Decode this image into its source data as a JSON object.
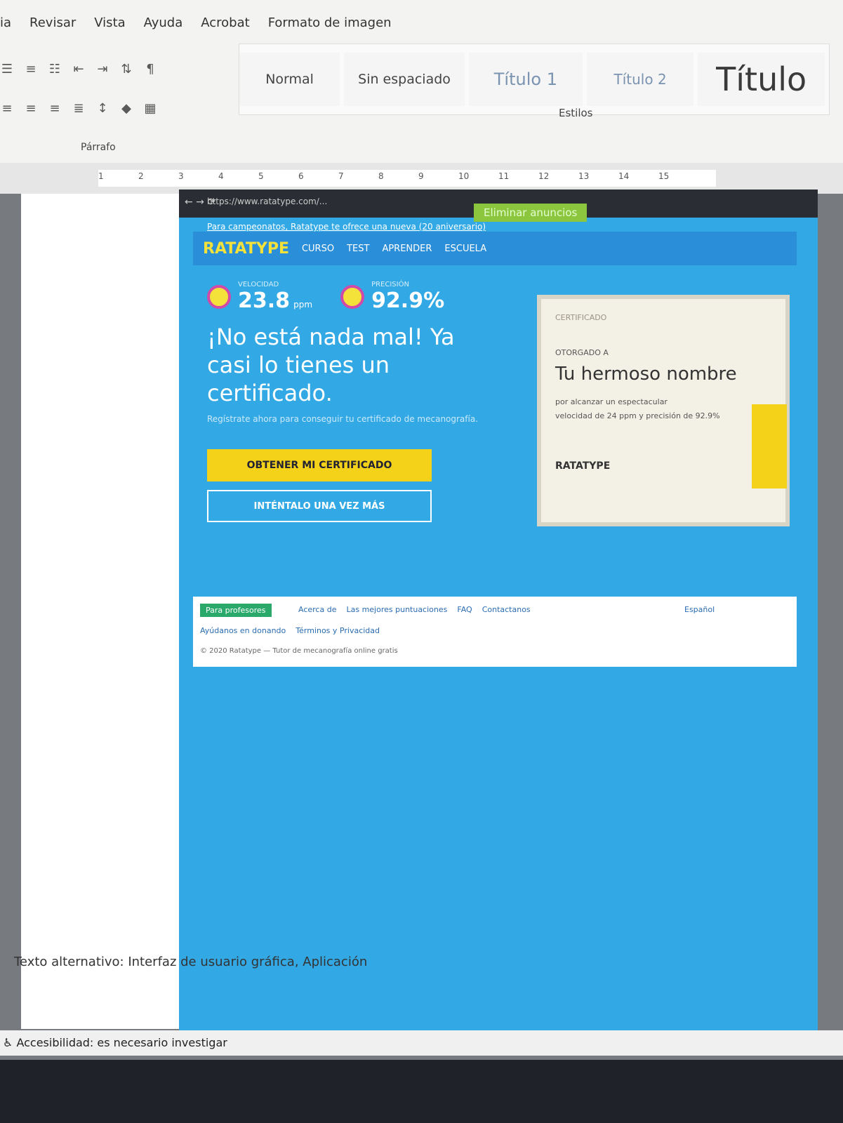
{
  "menu": [
    "ia",
    "Revisar",
    "Vista",
    "Ayuda",
    "Acrobat",
    "Formato de imagen"
  ],
  "paragraph_group_label": "Párrafo",
  "styles": {
    "normal": "Normal",
    "sin_espaciado": "Sin espaciado",
    "titulo1": "Título 1",
    "titulo2": "Título 2",
    "titulo": "Título",
    "group_label": "Estilos"
  },
  "ruler": [
    "1",
    "2",
    "3",
    "4",
    "5",
    "6",
    "7",
    "8",
    "9",
    "10",
    "11",
    "12",
    "13",
    "14",
    "15"
  ],
  "browser": {
    "url": "https://www.ratatype.com/...",
    "promo_link": "Para campeonatos, Ratatype te ofrece una nueva (20 aniversario)",
    "delete_button": "Eliminar anuncios",
    "logo": "RATATYPE",
    "nav": [
      "CURSO",
      "TEST",
      "APRENDER",
      "ESCUELA"
    ],
    "speed_label": "VELOCIDAD",
    "speed_value": "23.8",
    "speed_unit": "ppm",
    "accuracy_label": "PRECISIÓN",
    "accuracy_value": "92.9%",
    "headline": "¡No está nada mal! Ya casi lo tienes un certificado.",
    "sub_text": "Regístrate ahora para conseguir tu certificado de mecanografía.",
    "cert_button": "OBTENER MI CERTIFICADO",
    "retry_button": "INTÉNTALO UNA VEZ MÁS",
    "certificate": {
      "top": "CERTIFICADO",
      "otorgado": "OTORGADO A",
      "name": "Tu hermoso nombre",
      "line1": "por alcanzar un espectacular",
      "line2": "velocidad de 24 ppm y precisión de 92.9%",
      "brand": "RATATYPE"
    },
    "footer": {
      "badge": "Para profesores",
      "links": [
        "Acerca de",
        "Las mejores puntuaciones",
        "FAQ",
        "Contactanos"
      ],
      "links2": [
        "Ayúdanos en donando",
        "Términos y Privacidad"
      ],
      "copyright": "© 2020 Ratatype — Tutor de mecanografía online gratis",
      "lang": "Español"
    }
  },
  "alt_text": "Texto alternativo: Interfaz de usuario gráfica, Aplicación",
  "status": "Accesibilidad: es necesario investigar"
}
